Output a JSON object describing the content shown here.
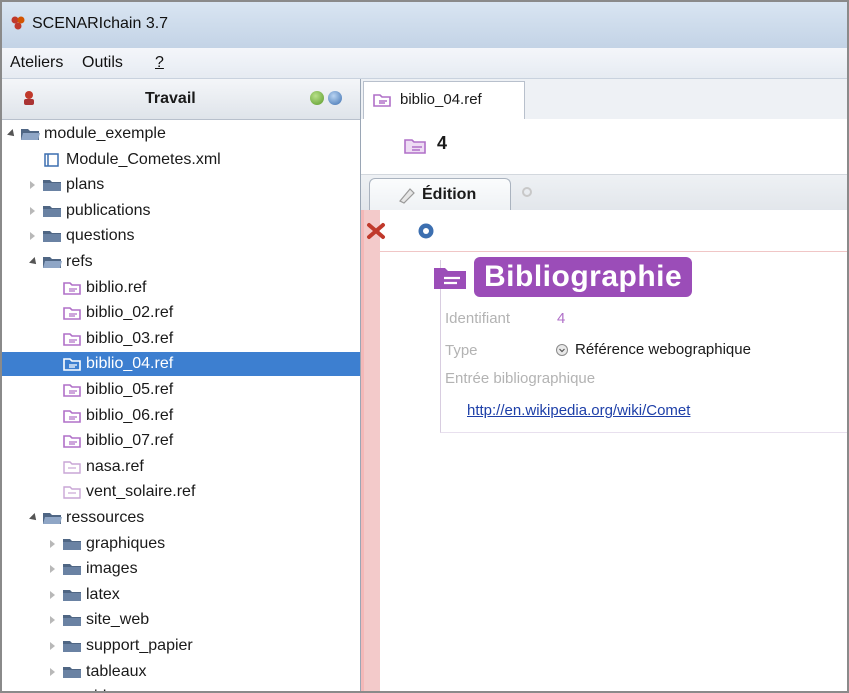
{
  "window": {
    "title": "SCENARIchain 3.7"
  },
  "menu": [
    "Ateliers",
    "Outils",
    "?"
  ],
  "left_panel": {
    "title": "Travail",
    "tree": [
      {
        "label": "module_exemple",
        "icon": "folder-open-icon",
        "twisty": "open",
        "depth": 0
      },
      {
        "label": "Module_Cometes.xml",
        "icon": "module-xml-icon",
        "twisty": "none",
        "depth": 1
      },
      {
        "label": "plans",
        "icon": "folder-icon",
        "twisty": "closed",
        "depth": 1
      },
      {
        "label": "publications",
        "icon": "folder-icon",
        "twisty": "closed",
        "depth": 1
      },
      {
        "label": "questions",
        "icon": "folder-icon",
        "twisty": "closed",
        "depth": 1
      },
      {
        "label": "refs",
        "icon": "folder-open-icon",
        "twisty": "open",
        "depth": 1
      },
      {
        "label": "biblio.ref",
        "icon": "ref-file-icon",
        "twisty": "none",
        "depth": 2
      },
      {
        "label": "biblio_02.ref",
        "icon": "ref-file-icon",
        "twisty": "none",
        "depth": 2
      },
      {
        "label": "biblio_03.ref",
        "icon": "ref-file-icon",
        "twisty": "none",
        "depth": 2
      },
      {
        "label": "biblio_04.ref",
        "icon": "ref-file-icon",
        "twisty": "none",
        "depth": 2,
        "selected": true
      },
      {
        "label": "biblio_05.ref",
        "icon": "ref-file-icon",
        "twisty": "none",
        "depth": 2
      },
      {
        "label": "biblio_06.ref",
        "icon": "ref-file-icon",
        "twisty": "none",
        "depth": 2
      },
      {
        "label": "biblio_07.ref",
        "icon": "ref-file-icon",
        "twisty": "none",
        "depth": 2
      },
      {
        "label": "nasa.ref",
        "icon": "ref-file-light-icon",
        "twisty": "none",
        "depth": 2
      },
      {
        "label": "vent_solaire.ref",
        "icon": "ref-file-light-icon",
        "twisty": "none",
        "depth": 2
      },
      {
        "label": "ressources",
        "icon": "folder-open-icon",
        "twisty": "open",
        "depth": 1
      },
      {
        "label": "graphiques",
        "icon": "folder-icon",
        "twisty": "closed",
        "depth": 2
      },
      {
        "label": "images",
        "icon": "folder-icon",
        "twisty": "closed",
        "depth": 2
      },
      {
        "label": "latex",
        "icon": "folder-icon",
        "twisty": "closed",
        "depth": 2
      },
      {
        "label": "site_web",
        "icon": "folder-icon",
        "twisty": "closed",
        "depth": 2
      },
      {
        "label": "support_papier",
        "icon": "folder-icon",
        "twisty": "closed",
        "depth": 2
      },
      {
        "label": "tableaux",
        "icon": "folder-icon",
        "twisty": "closed",
        "depth": 2
      },
      {
        "label": "video",
        "icon": "folder-icon",
        "twisty": "closed",
        "depth": 2
      }
    ]
  },
  "editor": {
    "tab_label": "biblio_04.ref",
    "header_value": "4",
    "edition_tab": "Édition",
    "heading": "Bibliographie",
    "fields": {
      "identifiant_label": "Identifiant",
      "identifiant_value": "4",
      "type_label": "Type",
      "type_value": "Référence webographique",
      "entree_label": "Entrée bibliographique",
      "entree_link": "http://en.wikipedia.org/wiki/Comet"
    }
  },
  "colors": {
    "selection": "#3d7fd0",
    "heading_bg": "#9b4db8",
    "ref_icon": "#b070c8",
    "folder": "#5a6f8c",
    "link": "#1d3fa8"
  }
}
